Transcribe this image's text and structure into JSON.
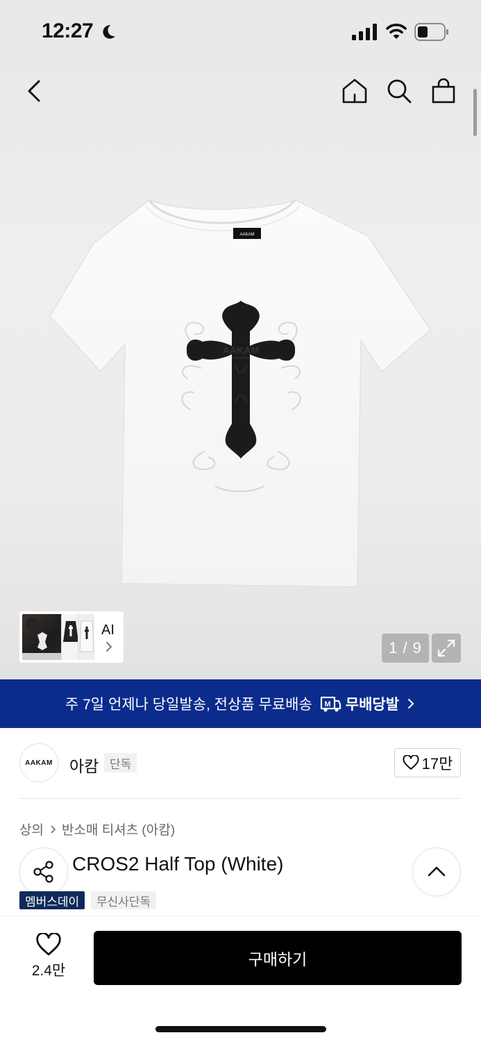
{
  "status_bar": {
    "time": "12:27",
    "moon_icon": "moon-icon",
    "signal_icon": "cellular-signal-icon",
    "wifi_icon": "wifi-icon",
    "battery_icon": "battery-icon",
    "battery_level": 0.35
  },
  "header": {
    "back_icon": "chevron-left-icon",
    "home_icon": "home-icon",
    "search_icon": "search-icon",
    "cart_icon": "shopping-bag-icon"
  },
  "gallery": {
    "ai_label": "AI",
    "counter": "1 / 9",
    "expand_icon": "expand-icon",
    "shirt_logo_text": "AAKAM",
    "cross_text": "AAKAM"
  },
  "banner": {
    "text": "주 7일 언제나 당일발송, 전상품 무료배송",
    "brand_text": "무배당발",
    "color": "#0b2c8c"
  },
  "brand": {
    "logo_text": "AAKAM",
    "name": "아캄",
    "tag": "단독",
    "likes": "17만"
  },
  "breadcrumb": {
    "level1": "상의",
    "level2": "반소매 티셔츠 (아캄)"
  },
  "product": {
    "title": "CROS2 Half Top (White)",
    "badges": [
      "멤버스데이",
      "무신사단독"
    ]
  },
  "bottom": {
    "wish_count": "2.4만",
    "buy_label": "구매하기"
  }
}
